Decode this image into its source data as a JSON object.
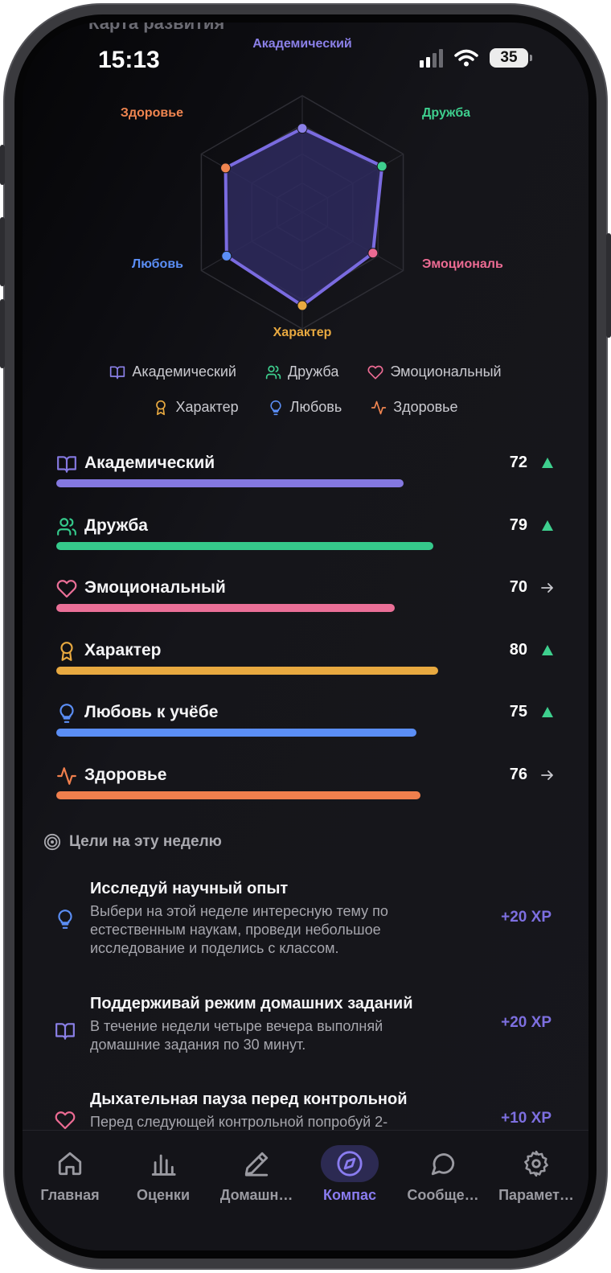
{
  "status_bar": {
    "time": "15:13",
    "battery": "35"
  },
  "page_title_partial": "Карта развития",
  "radar": {
    "axes": [
      {
        "label": "Академический",
        "value": 72,
        "color": "#8b80e8"
      },
      {
        "label": "Дружба",
        "value": 79,
        "color": "#3ecf8e"
      },
      {
        "label": "Эмоциональ",
        "value": 70,
        "color": "#ec6b93"
      },
      {
        "label": "Характер",
        "value": 80,
        "color": "#e8a940"
      },
      {
        "label": "Любовь",
        "value": 75,
        "color": "#5b8ef5"
      },
      {
        "label": "Здоровье",
        "value": 76,
        "color": "#f08550"
      }
    ],
    "max": 100,
    "fill_color": "#2e2a5e",
    "stroke_color": "#7a6be0"
  },
  "legend": [
    {
      "label": "Академический",
      "icon": "book-icon",
      "color": "#8b80e8"
    },
    {
      "label": "Дружба",
      "icon": "users-icon",
      "color": "#3ecf8e"
    },
    {
      "label": "Эмоциональный",
      "icon": "heart-icon",
      "color": "#ec6b93"
    },
    {
      "label": "Характер",
      "icon": "award-icon",
      "color": "#e8a940"
    },
    {
      "label": "Любовь",
      "icon": "lightbulb-icon",
      "color": "#5b8ef5"
    },
    {
      "label": "Здоровье",
      "icon": "activity-icon",
      "color": "#f08550"
    }
  ],
  "stats": [
    {
      "name": "Академический",
      "value": "72",
      "fraction": 0.72,
      "trend": "up",
      "icon": "book-icon",
      "color": "#8478e0"
    },
    {
      "name": "Дружба",
      "value": "79",
      "fraction": 0.79,
      "trend": "up",
      "icon": "users-icon",
      "color": "#35c98b"
    },
    {
      "name": "Эмоциональный",
      "value": "70",
      "fraction": 0.7,
      "trend": "flat",
      "icon": "heart-icon",
      "color": "#ea6f97"
    },
    {
      "name": "Характер",
      "value": "80",
      "fraction": 0.8,
      "trend": "up",
      "icon": "award-icon",
      "color": "#e8a940"
    },
    {
      "name": "Любовь к учёбе",
      "value": "75",
      "fraction": 0.75,
      "trend": "up",
      "icon": "lightbulb-icon",
      "color": "#5b8ef5"
    },
    {
      "name": "Здоровье",
      "value": "76",
      "fraction": 0.76,
      "trend": "flat",
      "icon": "activity-icon",
      "color": "#f07f4d"
    }
  ],
  "trend_colors": {
    "up": "#3ecf8e",
    "flat": "#c9c9cf"
  },
  "goals_header": "Цели на эту неделю",
  "goals": [
    {
      "title": "Исследуй научный опыт",
      "description": "Выбери на этой неделе интересную тему по естественным наукам, проведи небольшое исследование и поделись с классом.",
      "xp": "+20 XP",
      "icon": "lightbulb-icon",
      "color": "#5b8ef5"
    },
    {
      "title": "Поддерживай режим домашних заданий",
      "description": "В течение недели четыре вечера выполняй домашние задания по 30 минут.",
      "xp": "+20 XP",
      "icon": "book-icon",
      "color": "#8b80e8"
    },
    {
      "title": "Дыхательная пауза перед контрольной",
      "description": "Перед следующей контрольной попробуй 2-",
      "xp": "+10 XP",
      "icon": "heart-icon",
      "color": "#ec6b93"
    }
  ],
  "tabs": [
    {
      "label": "Главная",
      "icon": "home-icon",
      "active": false
    },
    {
      "label": "Оценки",
      "icon": "bar-chart-icon",
      "active": false
    },
    {
      "label": "Домашн…",
      "icon": "pencil-icon",
      "active": false
    },
    {
      "label": "Компас",
      "icon": "compass-icon",
      "active": true
    },
    {
      "label": "Сообще…",
      "icon": "message-icon",
      "active": false
    },
    {
      "label": "Парамет…",
      "icon": "gear-icon",
      "active": false
    }
  ]
}
